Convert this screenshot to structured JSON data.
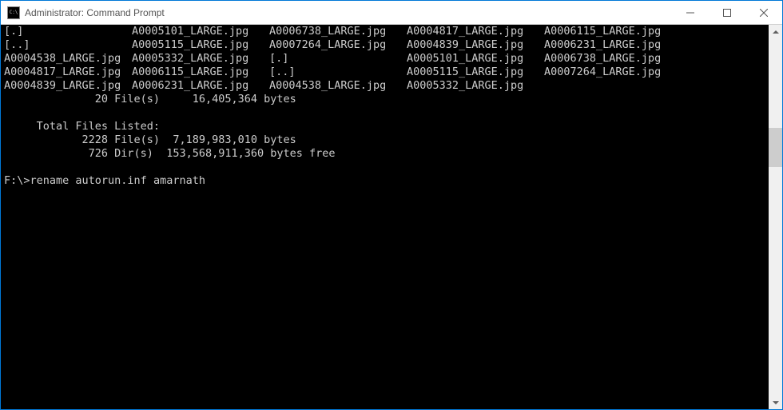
{
  "titlebar": {
    "text": "Administrator: Command Prompt"
  },
  "dir_rows": [
    [
      "[.]",
      "A0005101_LARGE.jpg",
      "A0006738_LARGE.jpg",
      "A0004817_LARGE.jpg",
      "A0006115_LARGE.jpg"
    ],
    [
      "[..]",
      "A0005115_LARGE.jpg",
      "A0007264_LARGE.jpg",
      "A0004839_LARGE.jpg",
      "A0006231_LARGE.jpg"
    ],
    [
      "A0004538_LARGE.jpg",
      "A0005332_LARGE.jpg",
      "[.]",
      "A0005101_LARGE.jpg",
      "A0006738_LARGE.jpg"
    ],
    [
      "A0004817_LARGE.jpg",
      "A0006115_LARGE.jpg",
      "[..]",
      "A0005115_LARGE.jpg",
      "A0007264_LARGE.jpg"
    ],
    [
      "A0004839_LARGE.jpg",
      "A0006231_LARGE.jpg",
      "A0004538_LARGE.jpg",
      "A0005332_LARGE.jpg",
      ""
    ]
  ],
  "summary": {
    "line1": "              20 File(s)     16,405,364 bytes",
    "blank": "",
    "total_header": "     Total Files Listed:",
    "files": "            2228 File(s)  7,189,983,010 bytes",
    "dirs": "             726 Dir(s)  153,568,911,360 bytes free"
  },
  "prompt": {
    "path": "F:\\>",
    "command": "rename autorun.inf amarnath"
  },
  "scrollbar": {
    "thumb_top_pct": 25,
    "thumb_height_pct": 11
  }
}
